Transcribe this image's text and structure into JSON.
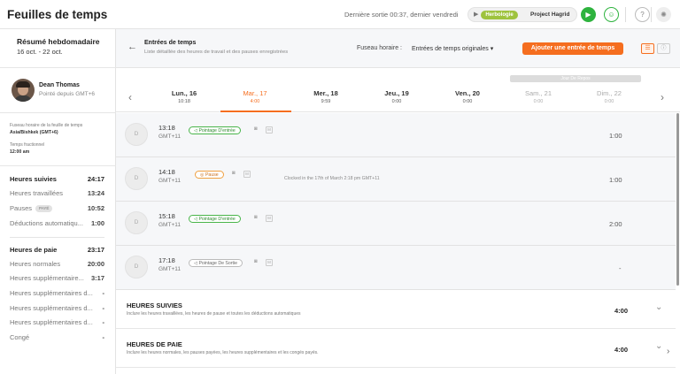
{
  "app": {
    "title": "Feuilles de temps",
    "last_out": "Dernière sortie 00:37, dernier vendredi"
  },
  "tracker": {
    "tag": "Herbologie",
    "project": "Project Hagrid"
  },
  "sidebar": {
    "title": "Résumé hebdomadaire",
    "range": "16 oct. - 22 oct.",
    "user_name": "Dean Thomas",
    "user_sub": "Pointé depuis GMT+6",
    "tz_label": "Fuseau horaire de la feuille de temps",
    "tz_value": "Asia/Bishkek (GMT+6)",
    "fraction_label": "Temps fractionnel",
    "fraction_value": "12:00 am",
    "tracked": [
      {
        "label": "Heures suivies",
        "value": "24:17",
        "header": true
      },
      {
        "label": "Heures travaillées",
        "value": "13:24"
      },
      {
        "label": "Pauses",
        "badge": "PAYÉ",
        "value": "10:52"
      },
      {
        "label": "Déductions automatiqu...",
        "value": "1:00"
      }
    ],
    "pay": [
      {
        "label": "Heures de paie",
        "value": "23:17",
        "header": true
      },
      {
        "label": "Heures normales",
        "value": "20:00"
      },
      {
        "label": "Heures supplémentaire...",
        "value": "3:17"
      },
      {
        "label": "Heures supplémentaires d...",
        "value": "-"
      },
      {
        "label": "Heures supplémentaires d...",
        "value": "-"
      },
      {
        "label": "Heures supplémentaires d...",
        "value": "-"
      },
      {
        "label": "Congé",
        "value": "-"
      }
    ]
  },
  "main": {
    "title": "Entrées de temps",
    "subtitle": "Liste détaillée des heures de travail et des pauses enregistrées",
    "tz_label": "Fuseau horaire :",
    "tz_select": "Entrées de temps originales",
    "add_button": "Ajouter une entrée de temps"
  },
  "days": {
    "holiday": "Jour De Repos",
    "items": [
      {
        "name": "Lun., 16",
        "hours": "10:18"
      },
      {
        "name": "Mar., 17",
        "hours": "4:00",
        "state": "active"
      },
      {
        "name": "Mer., 18",
        "hours": "9:59"
      },
      {
        "name": "Jeu., 19",
        "hours": "0:00"
      },
      {
        "name": "Ven., 20",
        "hours": "0:00"
      },
      {
        "name": "Sam., 21",
        "hours": "0:00",
        "state": "muted"
      },
      {
        "name": "Dim., 22",
        "hours": "0:00",
        "state": "muted"
      }
    ]
  },
  "entries": [
    {
      "initial": "D",
      "time": "13:18",
      "tz": "GMT+11",
      "type": "Pointage D'entrée",
      "style": "green",
      "note": "",
      "duration": "1:00"
    },
    {
      "initial": "D",
      "time": "14:18",
      "tz": "GMT+11",
      "type": "Pause",
      "style": "orange",
      "note": "Clocked in the 17th of March 2:18 pm GMT+11",
      "duration": "1:00"
    },
    {
      "initial": "D",
      "time": "15:18",
      "tz": "GMT+11",
      "type": "Pointage D'entrée",
      "style": "green",
      "note": "",
      "duration": "2:00"
    },
    {
      "initial": "D",
      "time": "17:18",
      "tz": "GMT+11",
      "type": "Pointage De Sortie",
      "style": "gray",
      "note": "",
      "duration": "-"
    }
  ],
  "summaries": [
    {
      "title": "HEURES SUIVIES",
      "sub": "Inclure les heures travaillées, les heures de pause et toutes les déductions automatiques",
      "value": "4:00"
    },
    {
      "title": "HEURES DE PAIE",
      "sub": "Inclure les heures normales, les pauses payées, les heures supplémentaires et les congés payés.",
      "value": "4:00"
    }
  ],
  "colors": {
    "accent": "#f56e1f",
    "green": "#2eb33e",
    "tag": "#9ec33d"
  },
  "icons": {
    "back": "arrow-left-icon",
    "play": "play-icon",
    "user": "user-icon",
    "help": "help-icon",
    "theme": "sun-icon"
  }
}
